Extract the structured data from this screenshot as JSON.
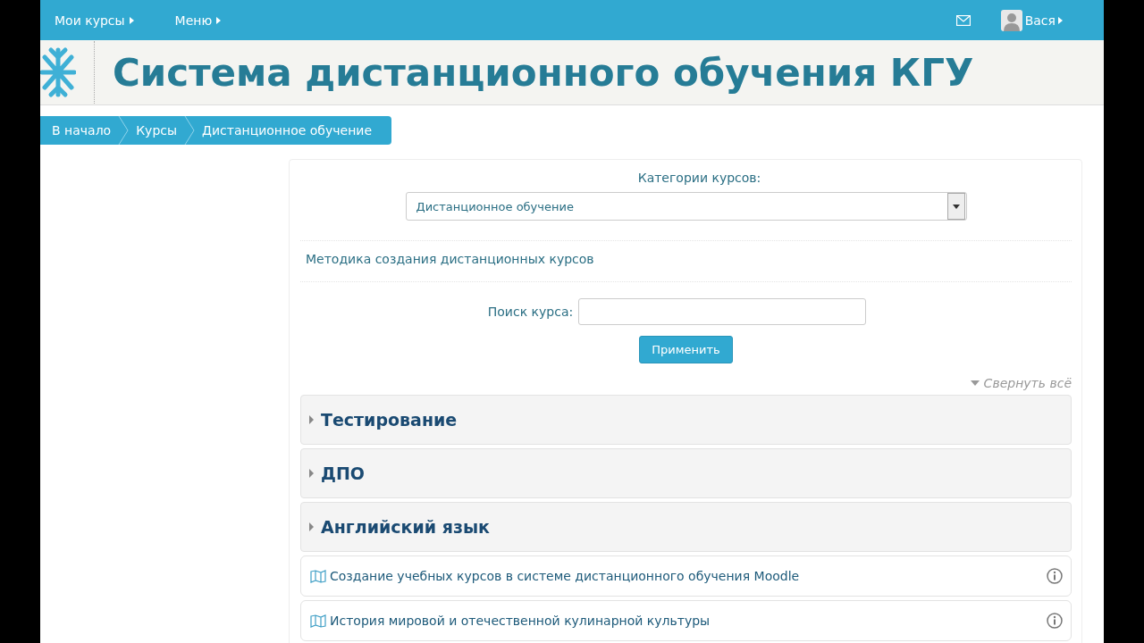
{
  "navbar": {
    "items": [
      {
        "label": "Мои курсы"
      },
      {
        "label": "Меню"
      }
    ],
    "user": {
      "name": "Вася"
    }
  },
  "header": {
    "title": "Система дистанционного обучения КГУ"
  },
  "breadcrumb": [
    "В начало",
    "Курсы",
    "Дистанционное обучение"
  ],
  "category_select": {
    "label": "Категории курсов:",
    "value": "Дистанционное обучение"
  },
  "subcategories": [
    "Методика создания дистанционных курсов"
  ],
  "search": {
    "label": "Поиск курса:",
    "button": "Применить"
  },
  "collapse_all": "Свернуть всё",
  "items": [
    {
      "kind": "category",
      "title": "Тестирование",
      "expanded": false
    },
    {
      "kind": "category",
      "title": "ДПО",
      "expanded": false
    },
    {
      "kind": "category",
      "title": "Английский язык",
      "expanded": false
    },
    {
      "kind": "course",
      "title": "Создание учебных курсов в системе дистанционного обучения Moodle"
    },
    {
      "kind": "course",
      "title": "История мировой и отечественной кулинарной культуры"
    }
  ]
}
